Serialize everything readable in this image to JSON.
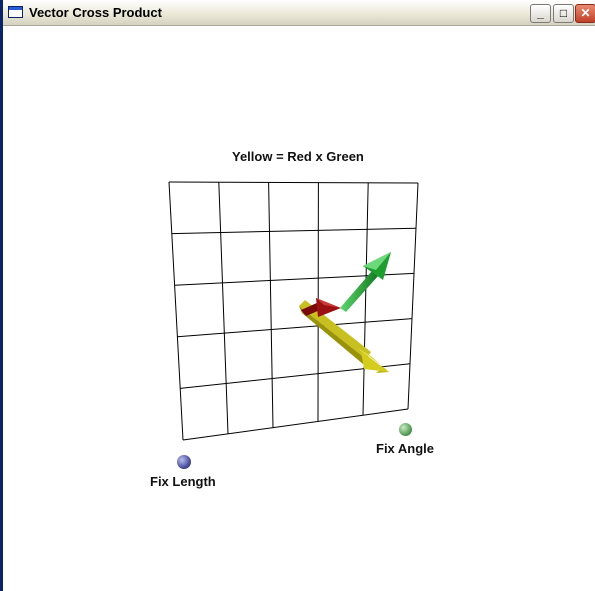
{
  "window": {
    "title": "Vector Cross Product",
    "icon": "window-app-icon",
    "controls": {
      "minimize": "_",
      "maximize": "□",
      "close": "✕"
    }
  },
  "scene": {
    "heading": "Yellow = Red x Green",
    "grid": {
      "rows": 5,
      "cols": 5
    },
    "vectors": [
      {
        "name": "red",
        "color": "#8b0000"
      },
      {
        "name": "green",
        "color": "#1e9e2e"
      },
      {
        "name": "yellow",
        "color": "#e2dc1a"
      }
    ],
    "handles": {
      "length": {
        "label": "Fix Length",
        "color": "#4a4f9e"
      },
      "angle": {
        "label": "Fix Angle",
        "color": "#5a9e5a"
      }
    }
  }
}
